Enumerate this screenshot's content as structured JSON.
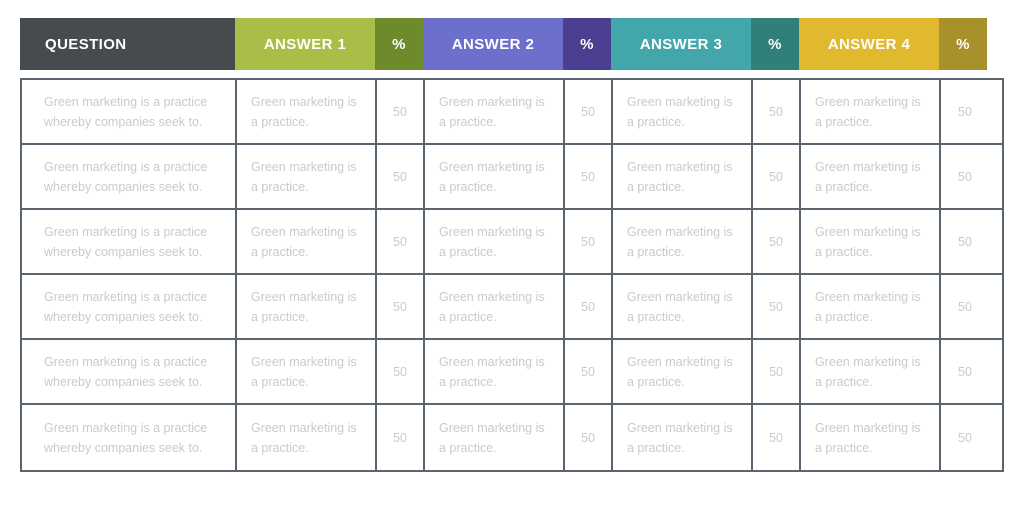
{
  "table": {
    "columns": [
      {
        "key": "question",
        "label": "QUESTION",
        "type": "question",
        "bg": "#454B4E"
      },
      {
        "key": "answer1",
        "label": "ANSWER 1",
        "type": "answer",
        "bg": "#A8BE47"
      },
      {
        "key": "pct1",
        "label": "%",
        "type": "pct",
        "bg": "#6E8B2B"
      },
      {
        "key": "answer2",
        "label": "ANSWER 2",
        "type": "answer",
        "bg": "#6C6FCB"
      },
      {
        "key": "pct2",
        "label": "%",
        "type": "pct",
        "bg": "#4A3F90"
      },
      {
        "key": "answer3",
        "label": "ANSWER 3",
        "type": "answer",
        "bg": "#43A6AA"
      },
      {
        "key": "pct3",
        "label": "%",
        "type": "pct",
        "bg": "#2E8079"
      },
      {
        "key": "answer4",
        "label": "ANSWER 4",
        "type": "answer",
        "bg": "#E0B92F"
      },
      {
        "key": "pct4",
        "label": "%",
        "type": "pct",
        "bg": "#A8912A"
      }
    ],
    "question_text": "Green marketing is a practice whereby companies seek to.",
    "answer_text": "Green marketing is a practice.",
    "percent_value": "50",
    "rows": [
      {
        "question": "Green marketing is a practice whereby companies seek to.",
        "answer1": "Green marketing is a practice.",
        "pct1": "50",
        "answer2": "Green marketing is a practice.",
        "pct2": "50",
        "answer3": "Green marketing is a practice.",
        "pct3": "50",
        "answer4": "Green marketing is a practice.",
        "pct4": "50"
      },
      {
        "question": "Green marketing is a practice whereby companies seek to.",
        "answer1": "Green marketing is a practice.",
        "pct1": "50",
        "answer2": "Green marketing is a practice.",
        "pct2": "50",
        "answer3": "Green marketing is a practice.",
        "pct3": "50",
        "answer4": "Green marketing is a practice.",
        "pct4": "50"
      },
      {
        "question": "Green marketing is a practice whereby companies seek to.",
        "answer1": "Green marketing is a practice.",
        "pct1": "50",
        "answer2": "Green marketing is a practice.",
        "pct2": "50",
        "answer3": "Green marketing is a practice.",
        "pct3": "50",
        "answer4": "Green marketing is a practice.",
        "pct4": "50"
      },
      {
        "question": "Green marketing is a practice whereby companies seek to.",
        "answer1": "Green marketing is a practice.",
        "pct1": "50",
        "answer2": "Green marketing is a practice.",
        "pct2": "50",
        "answer3": "Green marketing is a practice.",
        "pct3": "50",
        "answer4": "Green marketing is a practice.",
        "pct4": "50"
      },
      {
        "question": "Green marketing is a practice whereby companies seek to.",
        "answer1": "Green marketing is a practice.",
        "pct1": "50",
        "answer2": "Green marketing is a practice.",
        "pct2": "50",
        "answer3": "Green marketing is a practice.",
        "pct3": "50",
        "answer4": "Green marketing is a practice.",
        "pct4": "50"
      },
      {
        "question": "Green marketing is a practice whereby companies seek to.",
        "answer1": "Green marketing is a practice.",
        "pct1": "50",
        "answer2": "Green marketing is a practice.",
        "pct2": "50",
        "answer3": "Green marketing is a practice.",
        "pct3": "50",
        "answer4": "Green marketing is a practice.",
        "pct4": "50"
      }
    ]
  },
  "colors": {
    "question_header": "#454B4E",
    "answer1_header": "#A8BE47",
    "pct1_header": "#6E8B2B",
    "answer2_header": "#6C6FCB",
    "pct2_header": "#4A3F90",
    "answer3_header": "#43A6AA",
    "pct3_header": "#2E8079",
    "answer4_header": "#E0B92F",
    "pct4_header": "#A8912A",
    "cell_border": "#5A6570",
    "cell_text": "#C6CBD0",
    "header_text": "#FFFFFF",
    "page_background": "#FFFFFF"
  }
}
